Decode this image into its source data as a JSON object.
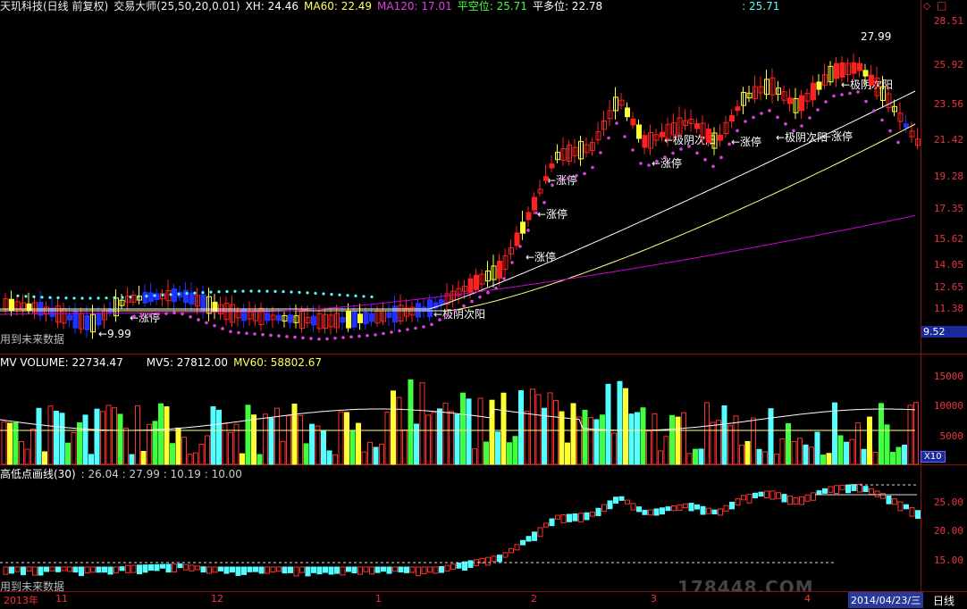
{
  "header": {
    "stock": "天玑科技(日线 前复权)",
    "indicator": "交易大师(25,50,20,0.01)",
    "xh": "XH: 24.46",
    "ma60": "MA60: 22.49",
    "ma120": "MA120: 17.01",
    "flat_short": "平空位: 25.71",
    "flat_long": "平多位: 22.78",
    "extra": ": 25.71"
  },
  "price_axis": [
    "28.51",
    "25.92",
    "23.56",
    "21.42",
    "19.28",
    "17.35",
    "15.62",
    "14.05",
    "12.65",
    "11.38"
  ],
  "price_badge": "9.52",
  "future_label_1": "用到未来数据",
  "future_label_2": "用到未来数据",
  "annotations": {
    "high": "27.99",
    "low": "←9.99",
    "zt": "←涨停",
    "jyc": "←极阴次阳"
  },
  "volume": {
    "title": "MV VOLUME: 22734.47",
    "mv5": "MV5: 27812.00",
    "mv60": "MV60: 58802.67",
    "axis": [
      "15000",
      "10000",
      "5000"
    ],
    "badge": "X10"
  },
  "lower": {
    "title": "高低点画线(30)",
    "values": ": 26.04 : 27.99 : 10.19 : 10.00",
    "axis": [
      "25.00",
      "20.00",
      "15.00"
    ]
  },
  "time_axis": [
    "2013年",
    "11",
    "12",
    "1",
    "2",
    "3",
    "4"
  ],
  "date_badge": "2014/04/23/三",
  "period": "日线",
  "watermark": "178448.COM",
  "colors": {
    "up": "#ff2020",
    "down": "#2030ff",
    "yellow": "#ffff33",
    "cyan": "#55ffff",
    "magenta": "#d000d0",
    "ma_white": "#ffffff",
    "ma_yellow": "#ffff80",
    "grid": "#8a1010"
  }
}
